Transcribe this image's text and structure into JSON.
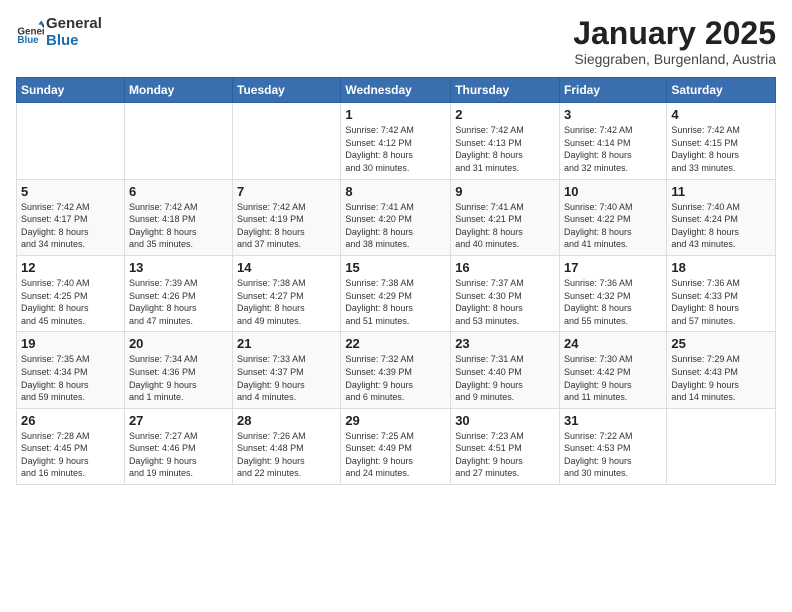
{
  "app": {
    "name_general": "General",
    "name_blue": "Blue"
  },
  "title": "January 2025",
  "location": "Sieggraben, Burgenland, Austria",
  "days_of_week": [
    "Sunday",
    "Monday",
    "Tuesday",
    "Wednesday",
    "Thursday",
    "Friday",
    "Saturday"
  ],
  "weeks": [
    [
      {
        "day": "",
        "info": ""
      },
      {
        "day": "",
        "info": ""
      },
      {
        "day": "",
        "info": ""
      },
      {
        "day": "1",
        "info": "Sunrise: 7:42 AM\nSunset: 4:12 PM\nDaylight: 8 hours\nand 30 minutes."
      },
      {
        "day": "2",
        "info": "Sunrise: 7:42 AM\nSunset: 4:13 PM\nDaylight: 8 hours\nand 31 minutes."
      },
      {
        "day": "3",
        "info": "Sunrise: 7:42 AM\nSunset: 4:14 PM\nDaylight: 8 hours\nand 32 minutes."
      },
      {
        "day": "4",
        "info": "Sunrise: 7:42 AM\nSunset: 4:15 PM\nDaylight: 8 hours\nand 33 minutes."
      }
    ],
    [
      {
        "day": "5",
        "info": "Sunrise: 7:42 AM\nSunset: 4:17 PM\nDaylight: 8 hours\nand 34 minutes."
      },
      {
        "day": "6",
        "info": "Sunrise: 7:42 AM\nSunset: 4:18 PM\nDaylight: 8 hours\nand 35 minutes."
      },
      {
        "day": "7",
        "info": "Sunrise: 7:42 AM\nSunset: 4:19 PM\nDaylight: 8 hours\nand 37 minutes."
      },
      {
        "day": "8",
        "info": "Sunrise: 7:41 AM\nSunset: 4:20 PM\nDaylight: 8 hours\nand 38 minutes."
      },
      {
        "day": "9",
        "info": "Sunrise: 7:41 AM\nSunset: 4:21 PM\nDaylight: 8 hours\nand 40 minutes."
      },
      {
        "day": "10",
        "info": "Sunrise: 7:40 AM\nSunset: 4:22 PM\nDaylight: 8 hours\nand 41 minutes."
      },
      {
        "day": "11",
        "info": "Sunrise: 7:40 AM\nSunset: 4:24 PM\nDaylight: 8 hours\nand 43 minutes."
      }
    ],
    [
      {
        "day": "12",
        "info": "Sunrise: 7:40 AM\nSunset: 4:25 PM\nDaylight: 8 hours\nand 45 minutes."
      },
      {
        "day": "13",
        "info": "Sunrise: 7:39 AM\nSunset: 4:26 PM\nDaylight: 8 hours\nand 47 minutes."
      },
      {
        "day": "14",
        "info": "Sunrise: 7:38 AM\nSunset: 4:27 PM\nDaylight: 8 hours\nand 49 minutes."
      },
      {
        "day": "15",
        "info": "Sunrise: 7:38 AM\nSunset: 4:29 PM\nDaylight: 8 hours\nand 51 minutes."
      },
      {
        "day": "16",
        "info": "Sunrise: 7:37 AM\nSunset: 4:30 PM\nDaylight: 8 hours\nand 53 minutes."
      },
      {
        "day": "17",
        "info": "Sunrise: 7:36 AM\nSunset: 4:32 PM\nDaylight: 8 hours\nand 55 minutes."
      },
      {
        "day": "18",
        "info": "Sunrise: 7:36 AM\nSunset: 4:33 PM\nDaylight: 8 hours\nand 57 minutes."
      }
    ],
    [
      {
        "day": "19",
        "info": "Sunrise: 7:35 AM\nSunset: 4:34 PM\nDaylight: 8 hours\nand 59 minutes."
      },
      {
        "day": "20",
        "info": "Sunrise: 7:34 AM\nSunset: 4:36 PM\nDaylight: 9 hours\nand 1 minute."
      },
      {
        "day": "21",
        "info": "Sunrise: 7:33 AM\nSunset: 4:37 PM\nDaylight: 9 hours\nand 4 minutes."
      },
      {
        "day": "22",
        "info": "Sunrise: 7:32 AM\nSunset: 4:39 PM\nDaylight: 9 hours\nand 6 minutes."
      },
      {
        "day": "23",
        "info": "Sunrise: 7:31 AM\nSunset: 4:40 PM\nDaylight: 9 hours\nand 9 minutes."
      },
      {
        "day": "24",
        "info": "Sunrise: 7:30 AM\nSunset: 4:42 PM\nDaylight: 9 hours\nand 11 minutes."
      },
      {
        "day": "25",
        "info": "Sunrise: 7:29 AM\nSunset: 4:43 PM\nDaylight: 9 hours\nand 14 minutes."
      }
    ],
    [
      {
        "day": "26",
        "info": "Sunrise: 7:28 AM\nSunset: 4:45 PM\nDaylight: 9 hours\nand 16 minutes."
      },
      {
        "day": "27",
        "info": "Sunrise: 7:27 AM\nSunset: 4:46 PM\nDaylight: 9 hours\nand 19 minutes."
      },
      {
        "day": "28",
        "info": "Sunrise: 7:26 AM\nSunset: 4:48 PM\nDaylight: 9 hours\nand 22 minutes."
      },
      {
        "day": "29",
        "info": "Sunrise: 7:25 AM\nSunset: 4:49 PM\nDaylight: 9 hours\nand 24 minutes."
      },
      {
        "day": "30",
        "info": "Sunrise: 7:23 AM\nSunset: 4:51 PM\nDaylight: 9 hours\nand 27 minutes."
      },
      {
        "day": "31",
        "info": "Sunrise: 7:22 AM\nSunset: 4:53 PM\nDaylight: 9 hours\nand 30 minutes."
      },
      {
        "day": "",
        "info": ""
      }
    ]
  ]
}
